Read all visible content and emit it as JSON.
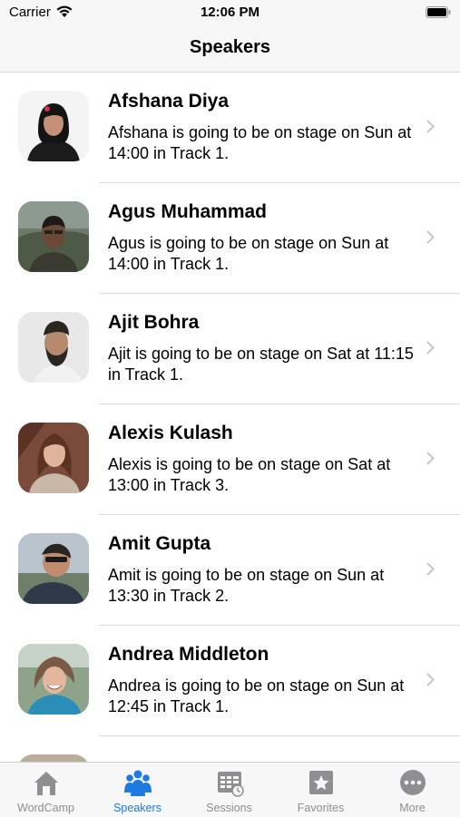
{
  "status_bar": {
    "carrier": "Carrier",
    "time": "12:06 PM"
  },
  "nav": {
    "title": "Speakers"
  },
  "speakers": [
    {
      "name": "Afshana Diya",
      "detail": "Afshana is going to be on stage on Sun at 14:00 in Track 1."
    },
    {
      "name": "Agus Muhammad",
      "detail": "Agus is going to be on stage on Sun at 14:00 in Track 1."
    },
    {
      "name": "Ajit Bohra",
      "detail": "Ajit is going to be on stage on Sat at 11:15 in Track 1."
    },
    {
      "name": "Alexis Kulash",
      "detail": "Alexis is going to be on stage on Sat at 13:00 in Track 3."
    },
    {
      "name": "Amit Gupta",
      "detail": "Amit is going to be on stage on Sun at 13:30 in Track 2."
    },
    {
      "name": "Andrea Middleton",
      "detail": "Andrea is going to be on stage on Sun at 12:45 in Track 1."
    }
  ],
  "tabs": [
    {
      "label": "WordCamp",
      "icon": "home-icon",
      "active": false
    },
    {
      "label": "Speakers",
      "icon": "people-icon",
      "active": true
    },
    {
      "label": "Sessions",
      "icon": "calendar-icon",
      "active": false
    },
    {
      "label": "Favorites",
      "icon": "star-icon",
      "active": false
    },
    {
      "label": "More",
      "icon": "more-icon",
      "active": false
    }
  ],
  "colors": {
    "accent": "#1f7ae0",
    "inactive": "#8e8e93",
    "bar_background": "#f7f7f7"
  }
}
